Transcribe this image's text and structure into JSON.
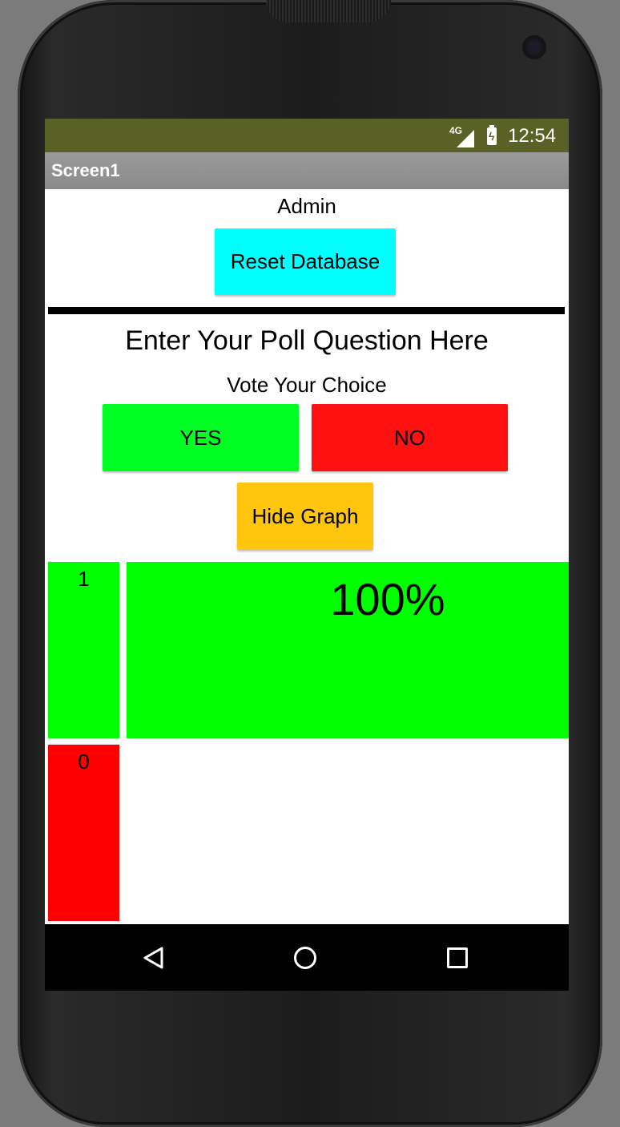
{
  "status_bar": {
    "network": "4G",
    "time": "12:54",
    "background": "#5a6126",
    "icons": [
      "signal-icon",
      "battery-charging-icon"
    ]
  },
  "app_bar": {
    "title": "Screen1"
  },
  "admin": {
    "label": "Admin",
    "reset_button": "Reset Database",
    "reset_color": "#00ffff"
  },
  "poll": {
    "question": "Enter Your Poll Question Here",
    "vote_label": "Vote Your Choice",
    "yes_label": "YES",
    "no_label": "NO",
    "yes_color": "#00ff22",
    "no_color": "#ff1111",
    "hide_graph_label": "Hide Graph",
    "hide_graph_color": "#ffc60d"
  },
  "results": {
    "yes_count": "1",
    "no_count": "0",
    "yes_percent_label": "100%",
    "yes_fraction": 1.0,
    "no_fraction": 0.0
  },
  "nav_bar": {
    "icons": [
      "back-icon",
      "home-icon",
      "recent-apps-icon"
    ]
  }
}
